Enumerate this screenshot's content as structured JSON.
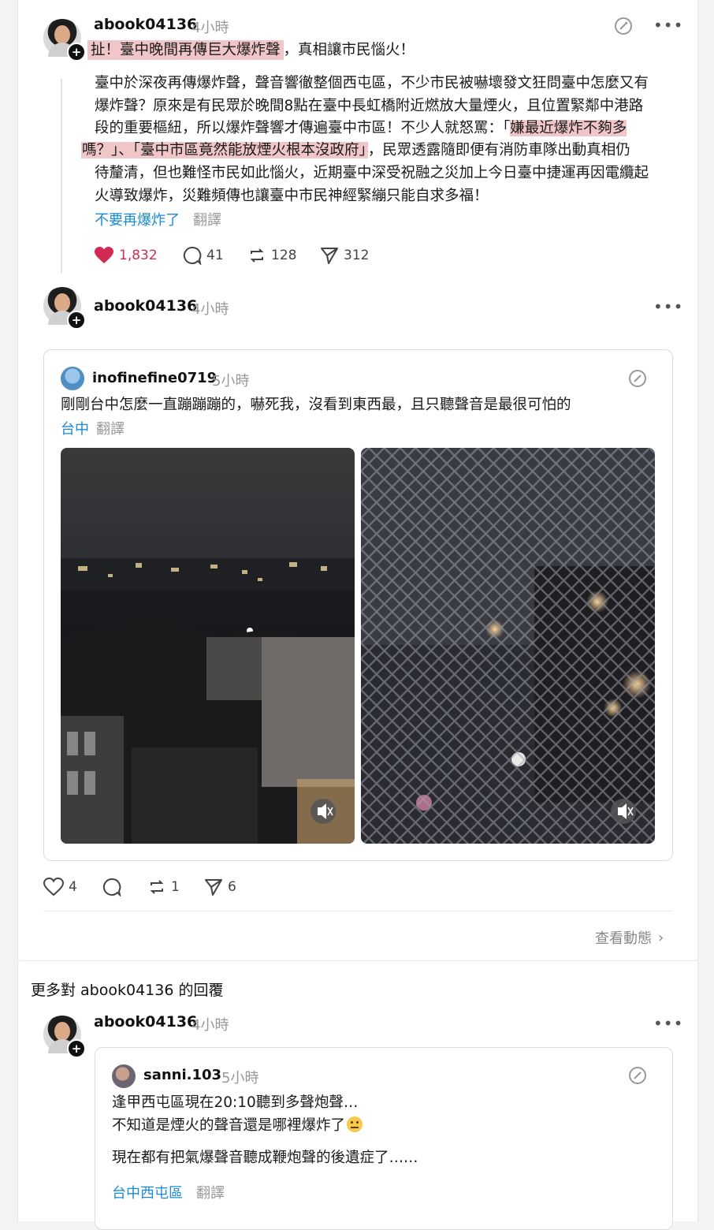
{
  "post1": {
    "username": "abook04136",
    "time": "4小時",
    "headline_highlight": "扯！臺中晚間再傳巨大爆炸聲",
    "headline_rest": "，真相讓市民惱火！",
    "lines": [
      "臺中於深夜再傳爆炸聲，聲音響徹整個西屯區，不少市民被嚇壞發文狂問臺中怎麼又有",
      "爆炸聲？原來是有民眾於晚間8點在臺中長虹橋附近燃放大量煙火，且位置緊鄰中港路",
      "段的重要樞紐，所以爆炸聲響才傳遍臺中市區！不少人就怒罵：「"
    ],
    "line3_highlight": "嫌最近爆炸不夠多",
    "line4_highlight": "嗎？」、「臺中市區竟然能放煙火根本沒政府」",
    "line4_rest": "，民眾透露隨即便有消防車隊出動真相仍",
    "lines_tail": [
      "待釐清，但也難怪市民如此惱火，近期臺中深受祝融之災加上今日臺中捷運再因電纜起",
      "火導致爆炸，災難頻傳也讓臺中市民神經緊繃只能自求多福！"
    ],
    "tag": "不要再爆炸了",
    "translate": "翻譯",
    "likes": "1,832",
    "comments": "41",
    "reposts": "128",
    "shares": "312"
  },
  "post2": {
    "username": "abook04136",
    "time": "4小時",
    "quoted": {
      "username": "inofinefine0719",
      "time": "5小時",
      "text": "剛剛台中怎麼一直蹦蹦蹦的，嚇死我，沒看到東西最，且只聽聲音是最很可怕的",
      "tag": "台中",
      "translate": "翻譯"
    },
    "likes": "4",
    "comments": "",
    "reposts": "1",
    "shares": "6",
    "view_activity": "查看動態"
  },
  "more_replies_title": "更多對 abook04136 的回覆",
  "post3": {
    "username": "abook04136",
    "time": "4小時",
    "quoted": {
      "username": "sanni.103",
      "time": "5小時",
      "line1": "逢甲西屯區現在20:10聽到多聲炮聲…",
      "line2": "不知道是煙火的聲音還是哪裡爆炸了",
      "line3": "現在都有把氣爆聲音聽成鞭炮聲的後遺症了……",
      "tag": "台中西屯區",
      "translate": "翻譯"
    }
  },
  "colors": {
    "highlight": "#f1c6c9",
    "like_red": "#d12b55",
    "link_blue": "#1a8ad6"
  }
}
